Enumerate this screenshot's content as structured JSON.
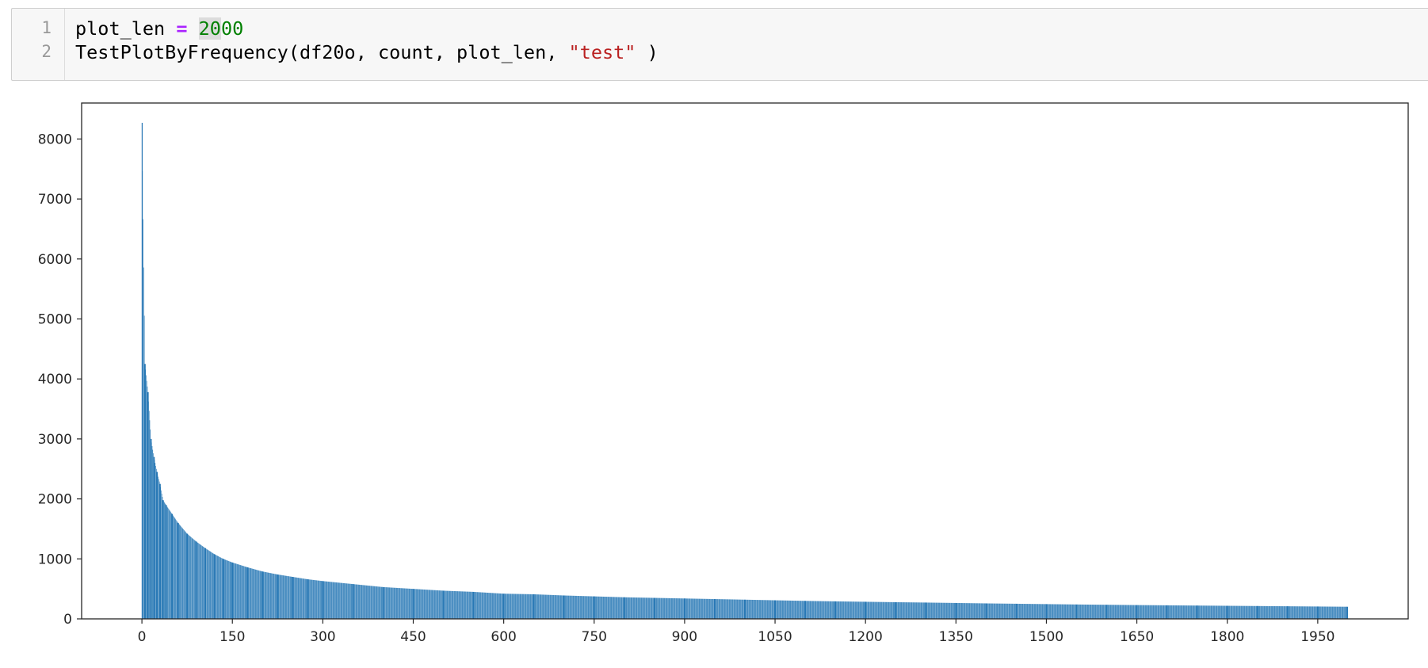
{
  "code_cell": {
    "line_numbers": [
      "1",
      "2"
    ],
    "line1": {
      "var": "plot_len",
      "op": "=",
      "num_hl": "20",
      "num_rest": "00"
    },
    "line2": {
      "call": "TestPlotByFrequency(df20o, count, plot_len, ",
      "str": "\"test\"",
      "tail": " )"
    }
  },
  "colors": {
    "bar": "#2878b5",
    "axis": "#262626"
  },
  "chart_data": {
    "type": "bar",
    "title": "",
    "xlabel": "",
    "ylabel": "",
    "xlim": [
      -100,
      2100
    ],
    "ylim": [
      0,
      8600
    ],
    "grid": false,
    "x_ticks": [
      0,
      150,
      300,
      450,
      600,
      750,
      900,
      1050,
      1200,
      1350,
      1500,
      1650,
      1800,
      1950
    ],
    "x_tick_labels": [
      "0",
      "150",
      "300",
      "450",
      "600",
      "750",
      "900",
      "1050",
      "1200",
      "1350",
      "1500",
      "1650",
      "1800",
      "1950"
    ],
    "y_ticks": [
      0,
      1000,
      2000,
      3000,
      4000,
      5000,
      6000,
      7000,
      8000
    ],
    "y_tick_labels": [
      "0",
      "1000",
      "2000",
      "3000",
      "4000",
      "5000",
      "6000",
      "7000",
      "8000"
    ],
    "series": [
      {
        "x": [
          0,
          5,
          10,
          15,
          20,
          25,
          30,
          35,
          40,
          50,
          60,
          75,
          90,
          105,
          120,
          135,
          150,
          175,
          200,
          225,
          250,
          275,
          300,
          350,
          400,
          450,
          500,
          550,
          600,
          650,
          700,
          750,
          800,
          850,
          900,
          950,
          1000,
          1050,
          1100,
          1150,
          1200,
          1250,
          1300,
          1350,
          1400,
          1450,
          1500,
          1550,
          1600,
          1650,
          1700,
          1750,
          1800,
          1850,
          1900,
          1950,
          1999
        ],
        "values": [
          8270,
          4250,
          3780,
          3000,
          2700,
          2450,
          2250,
          1980,
          1900,
          1750,
          1600,
          1420,
          1290,
          1180,
          1080,
          1000,
          940,
          860,
          790,
          740,
          700,
          660,
          630,
          580,
          530,
          500,
          470,
          450,
          420,
          410,
          390,
          375,
          360,
          350,
          340,
          330,
          320,
          310,
          300,
          292,
          285,
          278,
          272,
          265,
          258,
          252,
          246,
          240,
          235,
          230,
          226,
          222,
          218,
          214,
          210,
          206,
          202
        ]
      }
    ]
  }
}
